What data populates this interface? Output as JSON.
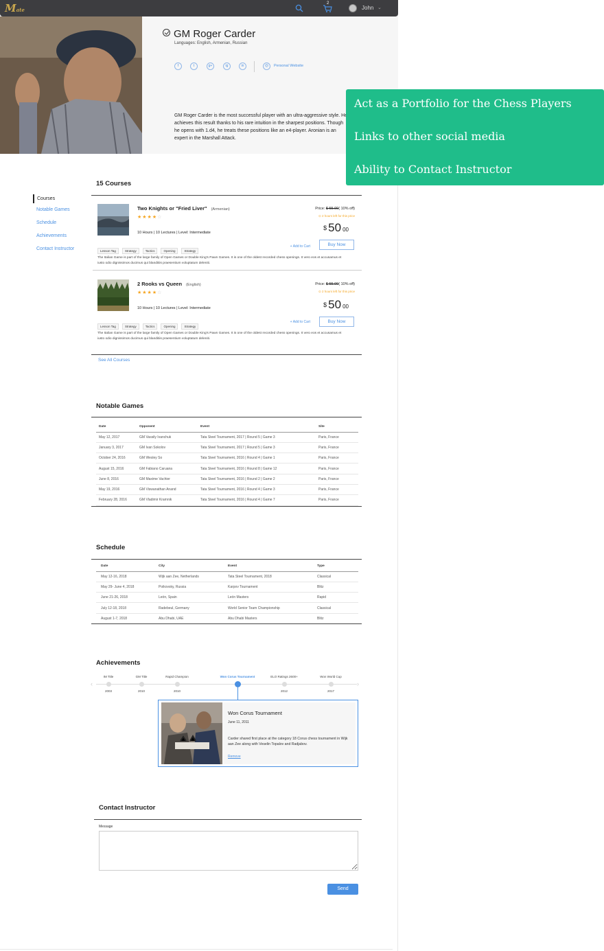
{
  "nav": {
    "logo_text": "M",
    "logo_sub": "ate",
    "cart_count": "2",
    "user_name": "John"
  },
  "profile": {
    "name": "GM Roger Carder",
    "languages": "Languages: English, Armenian, Russian",
    "socials": [
      "f",
      "t",
      "g+",
      "ig",
      "in"
    ],
    "website_label": "Personal Website",
    "bio": "GM Roger Carder is the most successful player with an ultra-aggressive style. He achieves this result thanks to his rare intuition in the sharpest positions.  Though he opens with 1.d4, he treats these positions like an e4-player. Aronian is an expert in the Marshall Attack."
  },
  "annotation": {
    "lines": [
      "Act as a Portfolio for the Chess Players",
      "Links to other social media",
      "Ability to Contact Instructor"
    ]
  },
  "sidenav": {
    "items": [
      "Courses",
      "Notable Games",
      "Schedule",
      "Achievements",
      "Contact Instructor"
    ]
  },
  "courses": {
    "heading": "15 Courses",
    "see_all": "See All Courses",
    "items": [
      {
        "title": "Two Knights or \"Fried Liver\"",
        "language": "(Armenian)",
        "stars": "★★★★",
        "star_off": "☆",
        "meta": "10 Hours  |  10 Lectures  |  Level: Intermediate",
        "price_label": "Price: ",
        "old_price": "$ 55.00",
        "discount": "( 10% off)",
        "time_left": "2 hours left for this price",
        "currency": "$",
        "price_main": "50",
        "price_cents": "00",
        "tags": [
          "Lesson Tag",
          "Strategy",
          "Tactics",
          "Opening",
          "Strategy"
        ],
        "add_cart": "+ Add to  Cart",
        "buy": "Buy Now",
        "desc": "The Italian Game is part of the large family of Open Games or Double King's Pawn Games. It is one of the oldest recorded chess openings. It vero eos et accusamus et iusto odio dignissimos ducimus qui blanditiis praesentium voluptatum deleniti."
      },
      {
        "title": "2 Rooks vs Queen",
        "language": "(English)",
        "stars": "★★★★",
        "star_off": "☆",
        "meta": "10 Hours  |  10 Lectures  |  Level: Intermediate",
        "price_label": "Price: ",
        "old_price": "$ 55.00",
        "discount": "( 10% off)",
        "time_left": "2 hours left for this price",
        "currency": "$",
        "price_main": "50",
        "price_cents": "00",
        "tags": [
          "Lesson Tag",
          "Strategy",
          "Tactics",
          "Opening",
          "Strategy"
        ],
        "add_cart": "+ Add to  Cart",
        "buy": "Buy Now",
        "desc": "The Italian Game is part of the large family of Open Games or Double King's Pawn Games. It is one of the oldest recorded chess openings. It vero eos et accusamus et iusto odio dignissimos ducimus qui blanditiis praesentium voluptatum deleniti."
      }
    ]
  },
  "games": {
    "heading": "Notable Games",
    "columns": [
      "Date",
      "Opponent",
      "Event",
      "Site"
    ],
    "rows": [
      [
        "May 12, 2017",
        "GM Vassily Ivanchuk",
        "Tata Steel Tournament, 2017 | Round 5 | Game 3",
        "Paris, France"
      ],
      [
        "January 3, 2017",
        "GM Ivan Sokolov",
        "Tata Steel Tournament, 2017 | Round 5 | Game 3",
        "Paris, France"
      ],
      [
        "October 24, 2016",
        "GM Wesley So",
        "Tata Steel Tournament, 2016 | Round 4 | Game 1",
        "Paris, France"
      ],
      [
        "August 15, 2016",
        "GM Fabiano Caruana",
        "Tata Steel Tournament, 2016 | Round 8 | Game 12",
        "Paris, France"
      ],
      [
        "June 8, 2016",
        "GM Maxime Vachier",
        "Tata Steel Tournament, 2016 | Round 2 | Game 2",
        "Paris, France"
      ],
      [
        "May 19, 2016",
        "GM Viswanathan Anand",
        "Tata Steel Tournament, 2016 | Round 4 | Game 3",
        "Paris, France"
      ],
      [
        "February 28, 2016",
        "GM Vladimir Kramnik",
        "Tata Steel Tournament, 2016 | Round 4 | Game 7",
        "Paris, France"
      ]
    ]
  },
  "schedule": {
    "heading": "Schedule",
    "columns": [
      "Date",
      "City",
      "Event",
      "Type"
    ],
    "rows": [
      [
        "May 12-16, 2018",
        "Wijk aan Zee, Netherlands",
        "Tata Steel Tournament, 2018",
        "Classical"
      ],
      [
        "May 29- June 4, 2018",
        "Poikovsky, Russia",
        "Karpov Tournament",
        "Blitz"
      ],
      [
        "June 21-26, 2018",
        "León, Spain",
        "León Masters",
        "Rapid"
      ],
      [
        "July 12-18, 2018",
        "Radebeul, Germany",
        "World Senior Team Championship",
        "Classical"
      ],
      [
        "August 1-7, 2018",
        "Abu Dhabi, UAE",
        "Abu Dhabi Masters",
        "Blitz"
      ]
    ]
  },
  "achievements": {
    "heading": "Achievements",
    "milestones": [
      {
        "label": "IM Title",
        "year": "2003"
      },
      {
        "label": "GM Title",
        "year": "2010"
      },
      {
        "label": "Rapid Champion",
        "year": "2010"
      },
      {
        "label": "Won Corus Tournament",
        "year": ""
      },
      {
        "label": "ELO Ratings 2600+",
        "year": "2012"
      },
      {
        "label": "Won World Cup",
        "year": "2017"
      }
    ],
    "detail": {
      "title": "Won Corus Tournament",
      "date": "June 11, 2011",
      "text": "Carder shared first place at the category 18 Corus chess tournament in Wijk aan Zee along with Veselin Topalov and Radjabov.",
      "remove": "Remove"
    }
  },
  "contact": {
    "heading": "Contact Instructor",
    "message_label": "Message",
    "send": "Send"
  }
}
